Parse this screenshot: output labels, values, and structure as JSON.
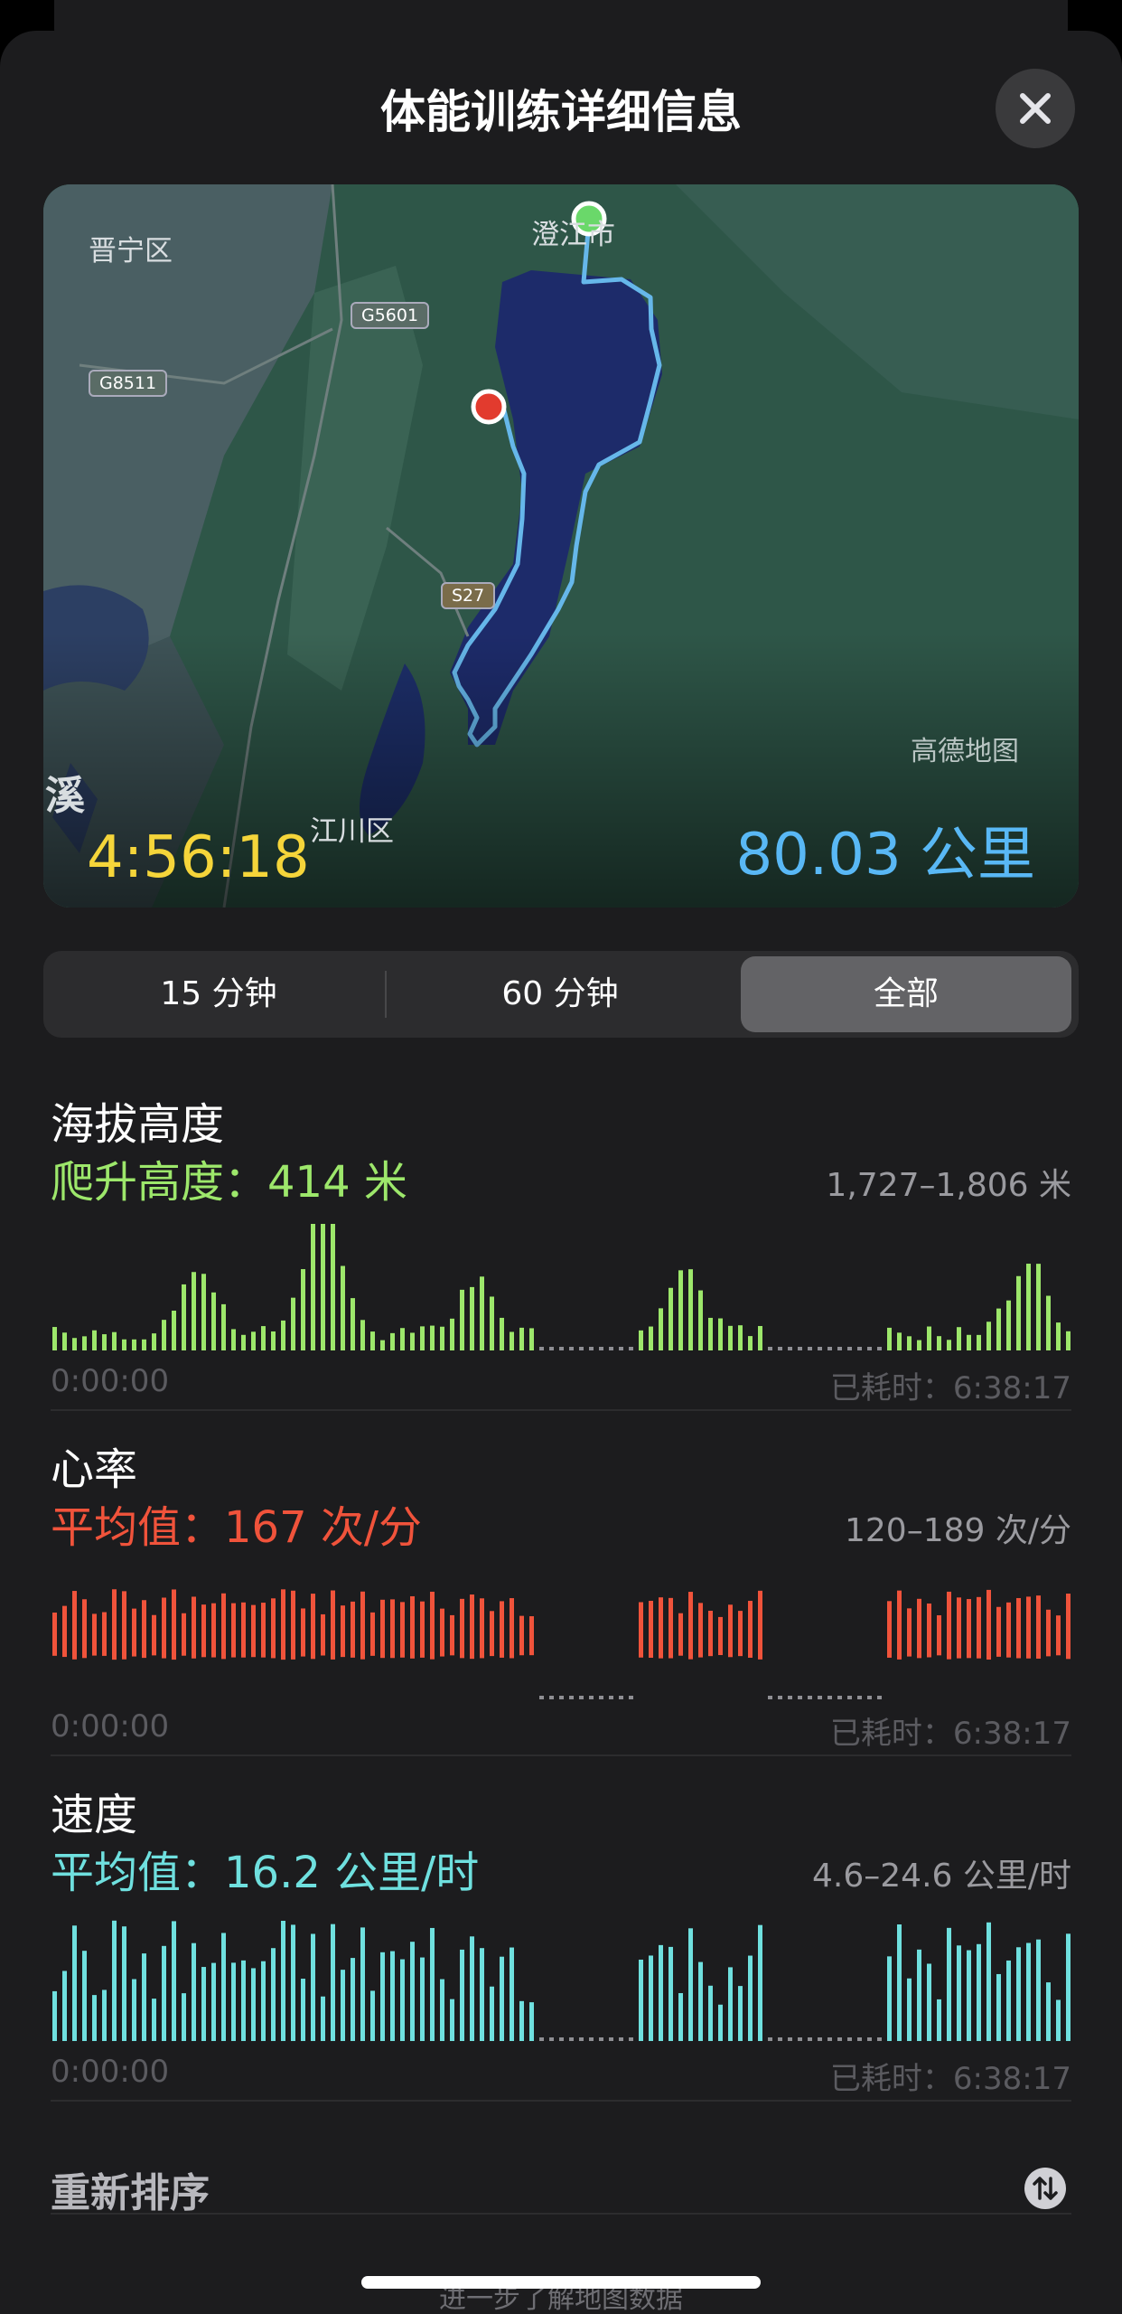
{
  "header": {
    "title": "体能训练详细信息"
  },
  "map": {
    "labels": {
      "puning": "晋宁区",
      "chengjiang": "澄江市",
      "jiangchuan": "江川区",
      "xi": "溪",
      "amap": "高德地图"
    },
    "road_shields": {
      "g5601": "G5601",
      "g8511": "G8511",
      "s27": "S27"
    },
    "duration": "4:56:18",
    "distance": "80.03 公里"
  },
  "segments": {
    "items": [
      "15 分钟",
      "60 分钟",
      "全部"
    ],
    "selected": "全部"
  },
  "elevation": {
    "title": "海拔高度",
    "value": "爬升高度：414 米",
    "range": "1,727–1,806 米",
    "start": "0:00:00",
    "end": "已耗时：6:38:17",
    "color": "#9de76b"
  },
  "heart_rate": {
    "title": "心率",
    "value": "平均值：167 次/分",
    "range": "120–189 次/分",
    "start": "0:00:00",
    "end": "已耗时：6:38:17",
    "color": "#f0533b"
  },
  "speed": {
    "title": "速度",
    "value": "平均值：16.2 公里/时",
    "range": "4.6–24.6 公里/时",
    "start": "0:00:00",
    "end": "已耗时：6:38:17",
    "color": "#6fe0df"
  },
  "footer": {
    "reorder": "重新排序",
    "learn_more": "进一步了解地图数据"
  },
  "icons": {
    "close": "close-icon",
    "reorder": "sort-arrows-icon"
  }
}
